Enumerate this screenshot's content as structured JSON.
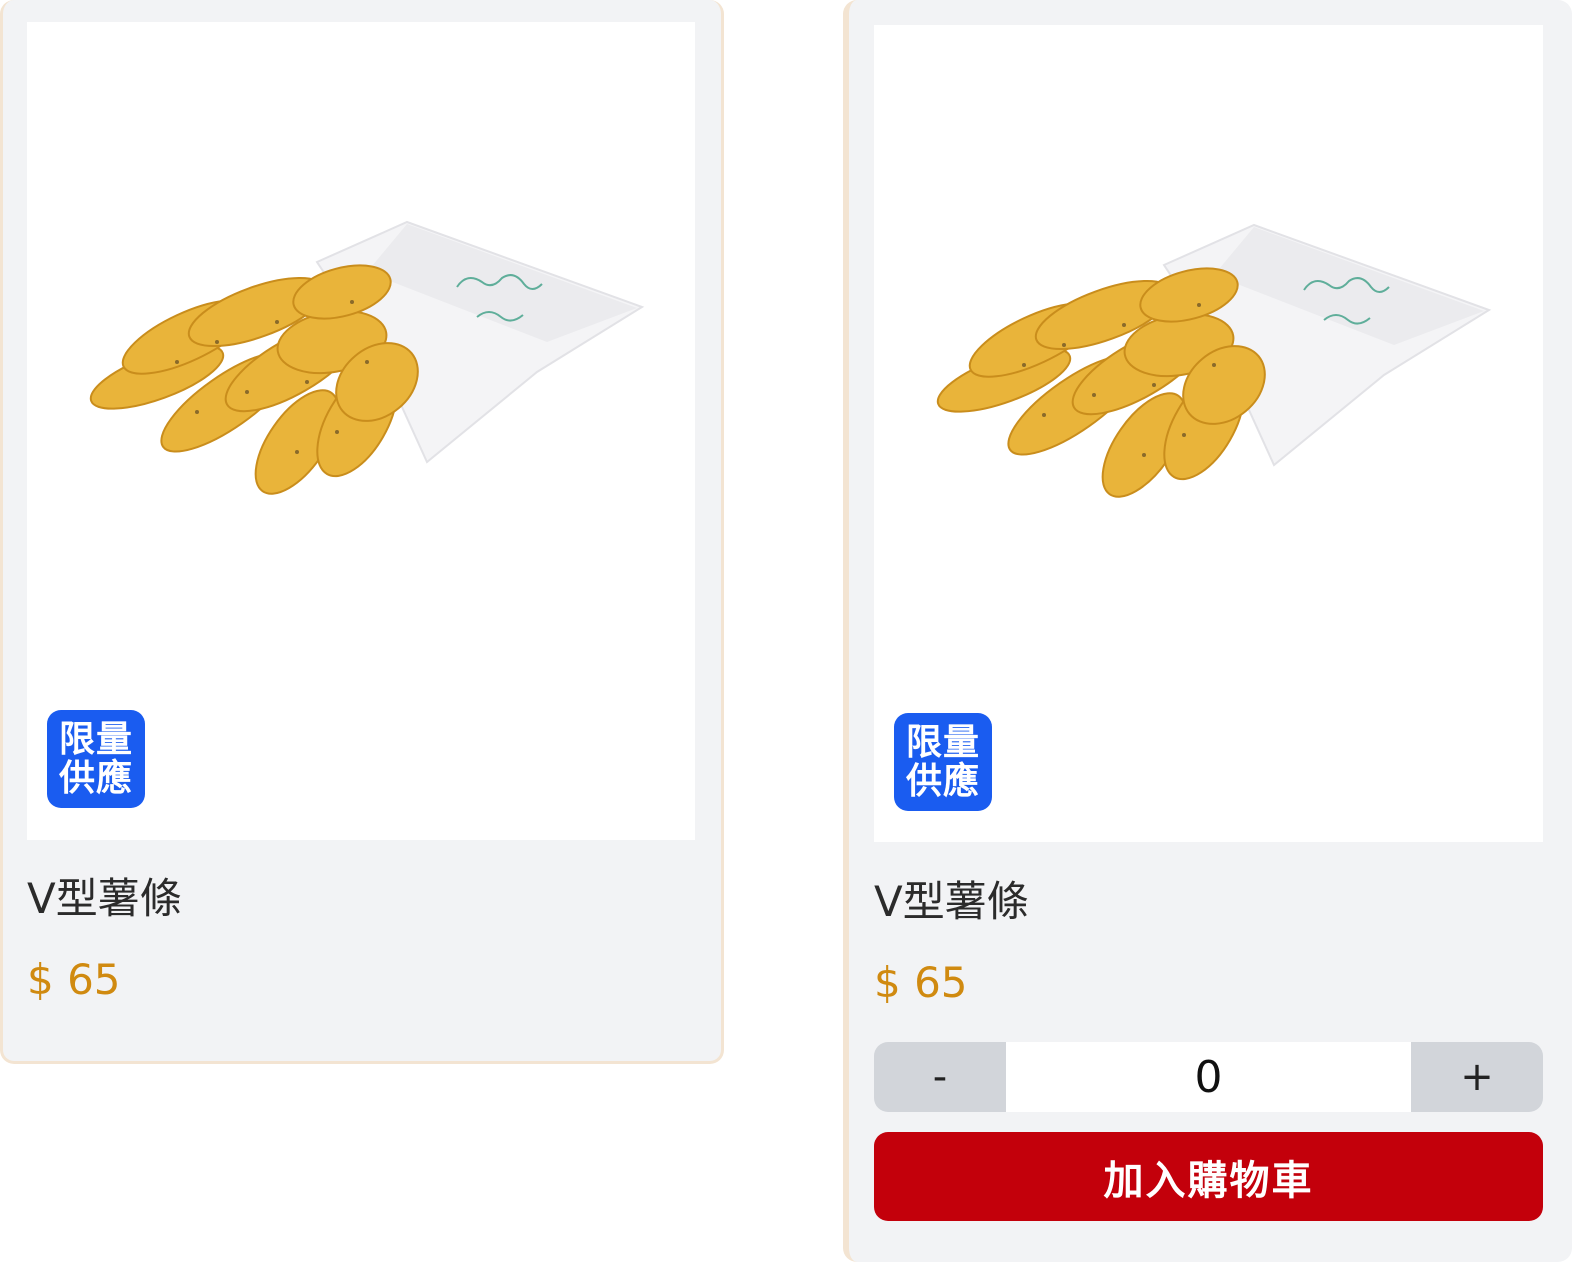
{
  "products": [
    {
      "name": "V型薯條",
      "price": "$ 65",
      "badge_line1": "限量",
      "badge_line2": "供應",
      "image_alt": "fries-image"
    },
    {
      "name": "V型薯條",
      "price": "$ 65",
      "badge_line1": "限量",
      "badge_line2": "供應",
      "image_alt": "fries-image",
      "quantity": "0",
      "minus_label": "-",
      "plus_label": "+",
      "add_to_cart_label": "加入購物車"
    }
  ],
  "colors": {
    "badge": "#1a5cf0",
    "price": "#d08a10",
    "add_to_cart": "#c3000b",
    "card_background": "#f2f3f5"
  }
}
